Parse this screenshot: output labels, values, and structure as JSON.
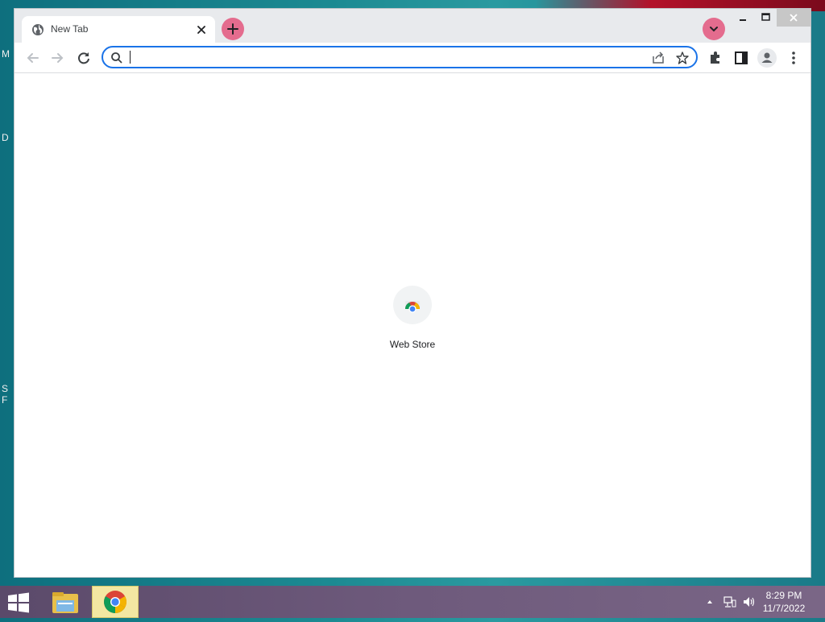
{
  "desktop": {
    "side_text": [
      "M",
      "D",
      "S",
      "F"
    ]
  },
  "browser": {
    "tab": {
      "title": "New Tab"
    },
    "omnibox": {
      "value": "",
      "placeholder": ""
    },
    "accent_color": "#1a73e8",
    "highlight_color": "#e46c8e"
  },
  "content": {
    "shortcuts": [
      {
        "label": "Web Store",
        "icon": "chrome-web-store-icon"
      }
    ]
  },
  "taskbar": {
    "apps": [
      "file-explorer-icon",
      "chrome-icon"
    ],
    "clock": {
      "time": "8:29 PM",
      "date": "11/7/2022"
    }
  }
}
